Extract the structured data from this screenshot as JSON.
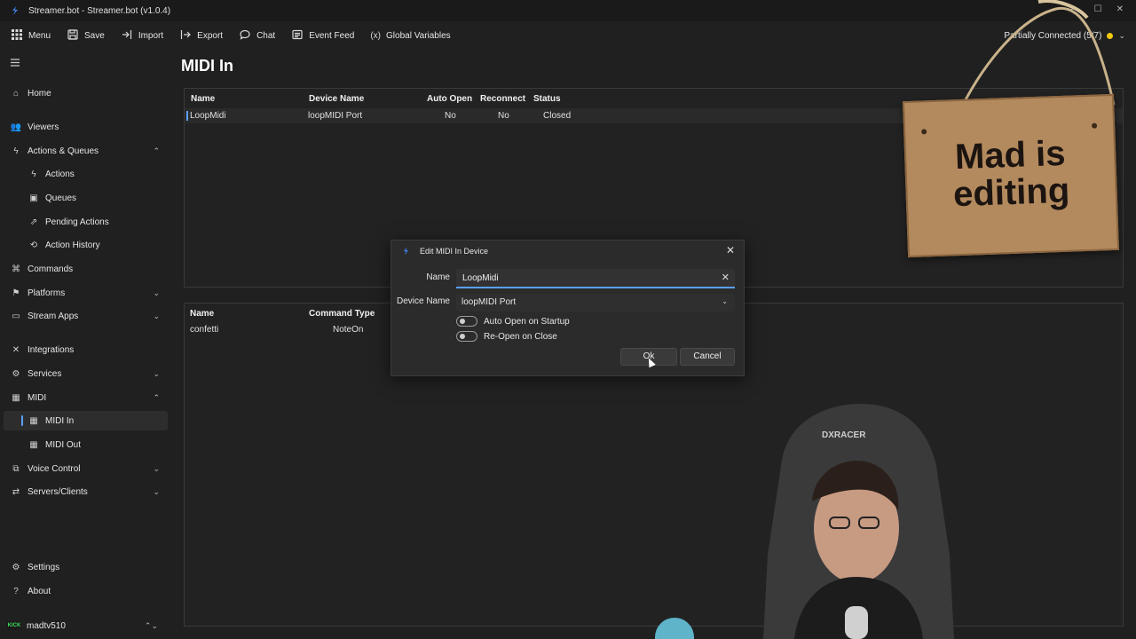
{
  "window": {
    "title": "Streamer.bot - Streamer.bot (v1.0.4)",
    "controls": [
      "—",
      "☐",
      "✕"
    ]
  },
  "toolbar": {
    "items": [
      {
        "icon": "grid-icon",
        "glyph": "⋮⋮",
        "label": "Menu"
      },
      {
        "icon": "save-icon",
        "glyph": "🖫",
        "label": "Save"
      },
      {
        "icon": "import-icon",
        "glyph": "⇥",
        "label": "Import"
      },
      {
        "icon": "export-icon",
        "glyph": "↦",
        "label": "Export"
      },
      {
        "icon": "chat-icon",
        "glyph": "💬",
        "label": "Chat"
      },
      {
        "icon": "event-feed-icon",
        "glyph": "▤",
        "label": "Event Feed"
      },
      {
        "icon": "variables-icon",
        "glyph": "(x)",
        "label": "Global Variables"
      }
    ],
    "connection_status": "Partially Connected (5/7)",
    "connection_color": "#f2c811"
  },
  "sidebar": {
    "items": [
      {
        "label": "Home",
        "icon": "home-icon",
        "glyph": "⌂"
      },
      {
        "label": "Viewers",
        "icon": "users-icon",
        "glyph": "👥"
      },
      {
        "label": "Actions & Queues",
        "icon": "bolt-icon",
        "glyph": "ϟ",
        "chevron": "⌃"
      },
      {
        "label": "Actions",
        "icon": "bolt-icon",
        "glyph": "ϟ"
      },
      {
        "label": "Queues",
        "icon": "queue-icon",
        "glyph": "▣"
      },
      {
        "label": "Pending Actions",
        "icon": "pending-icon",
        "glyph": "⇗"
      },
      {
        "label": "Action History",
        "icon": "history-icon",
        "glyph": "⟲"
      },
      {
        "label": "Commands",
        "icon": "command-icon",
        "glyph": "⌘"
      },
      {
        "label": "Platforms",
        "icon": "platforms-icon",
        "glyph": "⚑",
        "chevron": "⌄"
      },
      {
        "label": "Stream Apps",
        "icon": "stream-apps-icon",
        "glyph": "▭",
        "chevron": "⌄"
      },
      {
        "label": "Integrations",
        "icon": "integrations-icon",
        "glyph": "✕"
      },
      {
        "label": "Services",
        "icon": "services-icon",
        "glyph": "⚙",
        "chevron": "⌄"
      },
      {
        "label": "MIDI",
        "icon": "midi-icon",
        "glyph": "▦",
        "chevron": "⌃"
      },
      {
        "label": "MIDI In",
        "icon": "midi-in-icon",
        "glyph": "▦"
      },
      {
        "label": "MIDI Out",
        "icon": "midi-out-icon",
        "glyph": "▦"
      },
      {
        "label": "Voice Control",
        "icon": "voice-icon",
        "glyph": "⧉",
        "chevron": "⌄"
      },
      {
        "label": "Servers/Clients",
        "icon": "servers-icon",
        "glyph": "⇄",
        "chevron": "⌄"
      },
      {
        "label": "Settings",
        "icon": "gear-icon",
        "glyph": "⚙"
      },
      {
        "label": "About",
        "icon": "question-icon",
        "glyph": "?"
      }
    ],
    "user": {
      "name": "madtv510",
      "badge": "KICK",
      "chevron": "⌃⌄"
    }
  },
  "main": {
    "title": "MIDI In",
    "devices_table": {
      "headers": [
        "Name",
        "Device Name",
        "Auto Open",
        "Reconnect",
        "Status"
      ],
      "rows": [
        [
          "LoopMidi",
          "loopMIDI Port",
          "No",
          "No",
          "Closed"
        ]
      ]
    },
    "mappings_table": {
      "headers": [
        "Name",
        "Command Type"
      ],
      "rows": [
        [
          "confetti",
          "NoteOn"
        ]
      ]
    }
  },
  "dialog": {
    "title": "Edit MIDI In Device",
    "name_label": "Name",
    "name_value": "LoopMidi",
    "device_label": "Device Name",
    "device_value": "loopMIDI Port",
    "toggle_auto_open": "Auto Open on Startup",
    "toggle_reopen": "Re-Open on Close",
    "ok_label": "Ok",
    "cancel_label": "Cancel"
  },
  "overlay": {
    "sign_text": "Mad is editing",
    "chair_brand": "DXRACER"
  }
}
